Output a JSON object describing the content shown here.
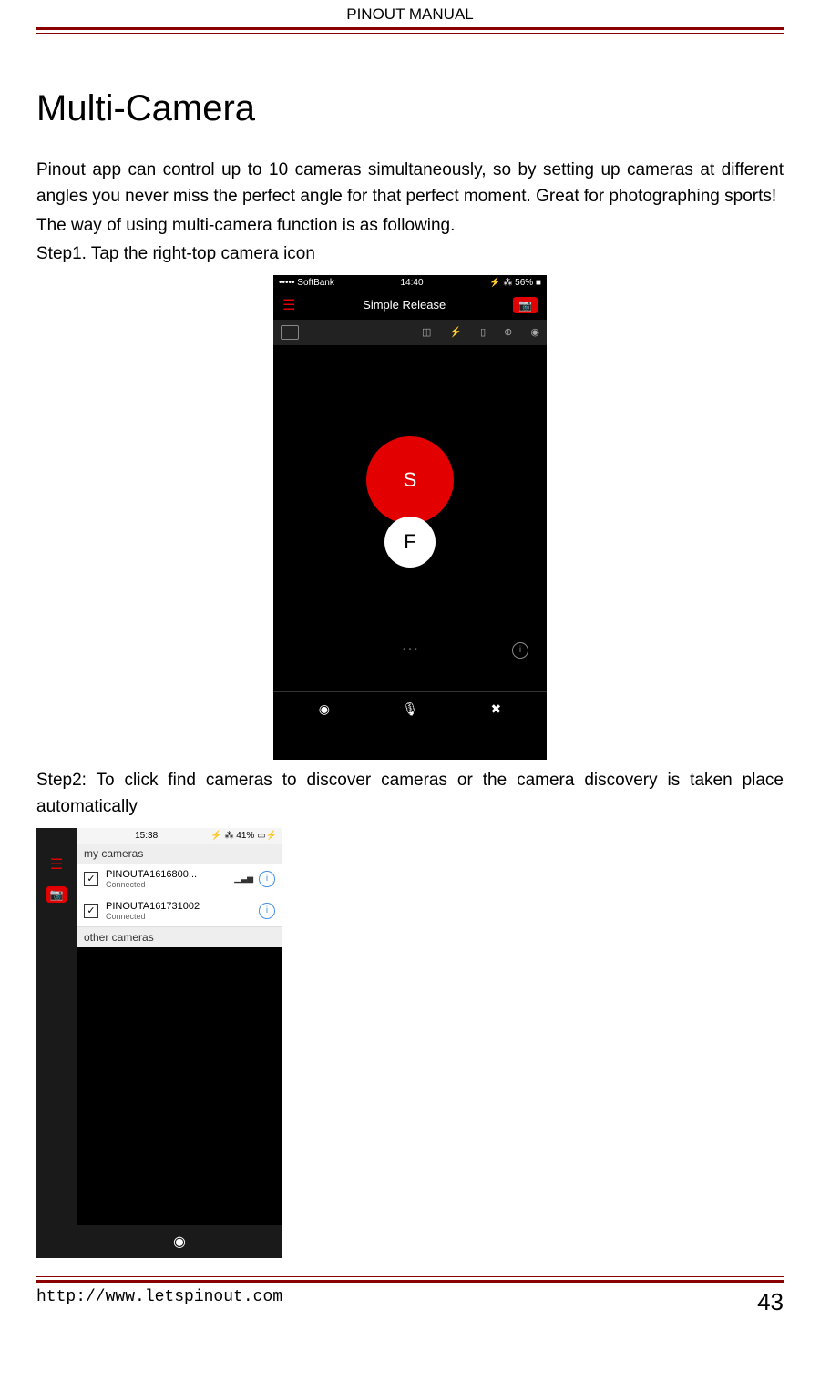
{
  "header": {
    "title": "PINOUT MANUAL"
  },
  "content": {
    "heading": "Multi-Camera",
    "paragraph1": "Pinout app can control up to 10 cameras simultaneously, so by setting up cameras at different angles you never miss the perfect angle for that perfect moment. Great for photographing sports!",
    "paragraph2": "The way of using multi-camera function is as following.",
    "step1": "Step1. Tap the right-top camera icon",
    "step2": "Step2: To click find cameras to discover cameras or the camera discovery is taken place automatically"
  },
  "screenshot1": {
    "carrier": "••••• SoftBank",
    "wifi": "ᯤ",
    "time": "14:40",
    "battery": "56%",
    "bt": "⚡ ⁂",
    "title": "Simple Release",
    "s_label": "S",
    "f_label": "F",
    "dots": "• • •",
    "info": "i",
    "rec": "◉",
    "mic": "🎤",
    "tools": "✕"
  },
  "screenshot2": {
    "time": "15:38",
    "battery": "41%",
    "bt": "⚡ ⁂",
    "section_my": "my cameras",
    "section_other": "other cameras",
    "cam1_name": "PINOUTA1616800...",
    "cam1_status": "Connected",
    "cam2_name": "PINOUTA161731002",
    "cam2_status": "Connected",
    "check": "✓",
    "info": "i",
    "signal": "▁▃▅",
    "rec": "◉"
  },
  "footer": {
    "url": "http://www.letspinout.com",
    "page": "43"
  }
}
